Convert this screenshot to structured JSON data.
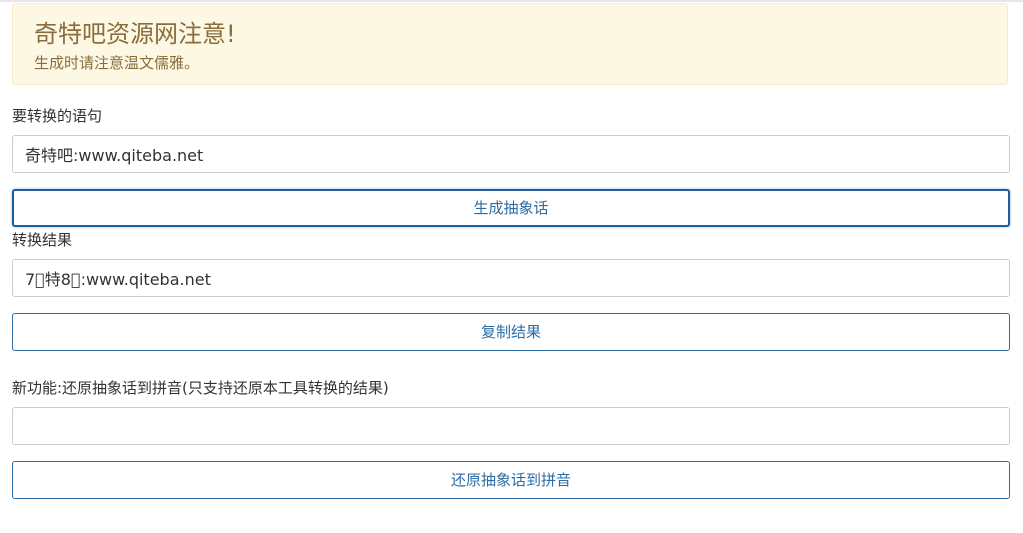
{
  "alert": {
    "title": "奇特吧资源网注意!",
    "text": "生成时请注意温文儒雅。"
  },
  "source": {
    "label": "要转换的语句",
    "value": "奇特吧:www.qiteba.net"
  },
  "generate_button": {
    "label": "生成抽象话"
  },
  "result": {
    "label": "转换结果",
    "value": "7􀀀特8􀀀:www.qiteba.net"
  },
  "copy_button": {
    "label": "复制结果"
  },
  "restore": {
    "label": "新功能:还原抽象话到拼音(只支持还原本工具转换的结果)",
    "value": ""
  },
  "restore_button": {
    "label": "还原抽象话到拼音"
  },
  "colors": {
    "alert_bg": "#fcf8e3",
    "alert_text": "#8a6d3b",
    "button_border": "#2e6da4"
  }
}
